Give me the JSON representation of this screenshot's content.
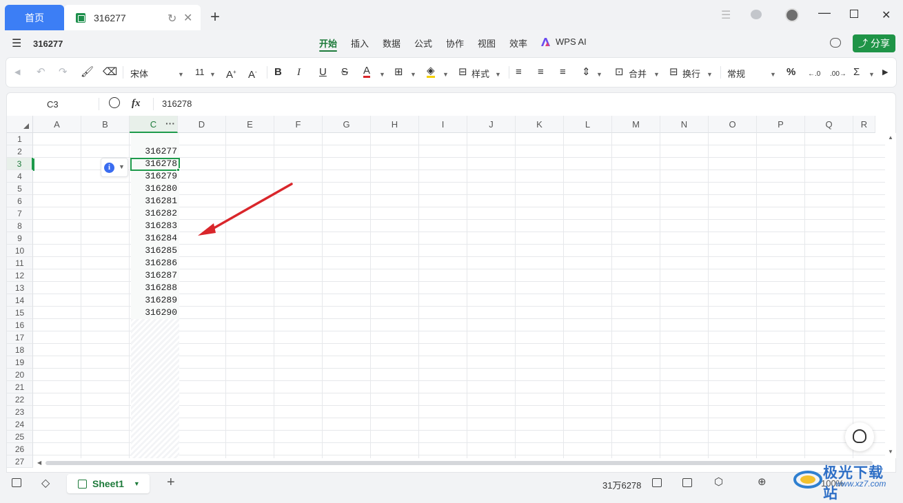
{
  "tabs": {
    "home": "首页",
    "document": "316277"
  },
  "menubar": {
    "filename": "316277",
    "ribbon": [
      "开始",
      "插入",
      "数据",
      "公式",
      "协作",
      "视图",
      "效率"
    ],
    "wps_ai": "WPS AI",
    "share": "分享"
  },
  "toolbar": {
    "font": "宋体",
    "font_size": "11",
    "style": "样式",
    "merge": "合并",
    "wrap": "换行",
    "number_format": "常规"
  },
  "formula": {
    "cell_ref": "C3",
    "fx": "fx",
    "value": "316278"
  },
  "columns": [
    "A",
    "B",
    "C",
    "D",
    "E",
    "F",
    "G",
    "H",
    "I",
    "J",
    "K",
    "L",
    "M",
    "N",
    "O",
    "P",
    "Q",
    "R"
  ],
  "rows": [
    "1",
    "2",
    "3",
    "4",
    "5",
    "6",
    "7",
    "8",
    "9",
    "10",
    "11",
    "12",
    "13",
    "14",
    "15",
    "16",
    "17",
    "18",
    "19",
    "20",
    "21",
    "22",
    "23",
    "24",
    "25",
    "26",
    "27"
  ],
  "cells_c": [
    "316277",
    "316278",
    "316279",
    "316280",
    "316281",
    "316282",
    "316283",
    "316284",
    "316285",
    "316286",
    "316287",
    "316288",
    "316289",
    "316290"
  ],
  "selected": {
    "column": "C",
    "row": "3"
  },
  "statusbar": {
    "sheet_name": "Sheet1",
    "sum": "31万6278",
    "zoom": "100%"
  },
  "watermark": {
    "name": "极光下载站",
    "url": "www.xz7.com"
  },
  "colors": {
    "accent_green": "#1d9a4b",
    "home_tab_blue": "#3c7ef5",
    "arrow_red": "#d9262b"
  }
}
